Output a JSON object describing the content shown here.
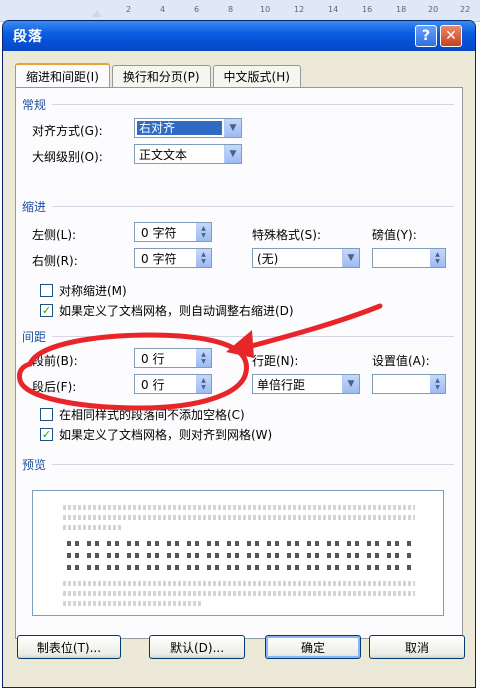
{
  "ruler": {
    "numbers": [
      "2",
      "4",
      "6",
      "8",
      "10",
      "12",
      "14",
      "16",
      "18",
      "20",
      "22"
    ]
  },
  "window": {
    "title": "段落",
    "help_glyph": "?",
    "close_glyph": "✕"
  },
  "tabs": [
    {
      "label": "缩进和间距(I)",
      "active": true
    },
    {
      "label": "换行和分页(P)",
      "active": false
    },
    {
      "label": "中文版式(H)",
      "active": false
    }
  ],
  "general": {
    "title": "常规",
    "alignment_label": "对齐方式(G):",
    "alignment_value": "右对齐",
    "outline_label": "大纲级别(O):",
    "outline_value": "正文文本"
  },
  "indent": {
    "title": "缩进",
    "left_label": "左侧(L):",
    "left_value": "0 字符",
    "right_label": "右侧(R):",
    "right_value": "0 字符",
    "special_label": "特殊格式(S):",
    "special_value": "(无)",
    "by_label": "磅值(Y):",
    "by_value": "",
    "mirror_label": "对称缩进(M)",
    "mirror_checked": false,
    "grid_label": "如果定义了文档网格，则自动调整右缩进(D)",
    "grid_checked": true
  },
  "spacing": {
    "title": "间距",
    "before_label": "段前(B):",
    "before_value": "0 行",
    "after_label": "段后(F):",
    "after_value": "0 行",
    "line_label": "行距(N):",
    "line_value": "单倍行距",
    "at_label": "设置值(A):",
    "at_value": "",
    "nospace_label": "在相同样式的段落间不添加空格(C)",
    "nospace_checked": false,
    "snap_label": "如果定义了文档网格，则对齐到网格(W)",
    "snap_checked": true
  },
  "preview": {
    "title": "预览"
  },
  "buttons": {
    "tabs": "制表位(T)...",
    "default": "默认(D)...",
    "ok": "确定",
    "cancel": "取消"
  },
  "colors": {
    "annotation": "#e8262a",
    "titlebar": "#0b5ee0",
    "section_title": "#1e4fa0"
  },
  "icons": {
    "dropdown": "chevron-down-icon",
    "spinner": "spin-arrows-icon",
    "check": "checkmark-icon"
  }
}
